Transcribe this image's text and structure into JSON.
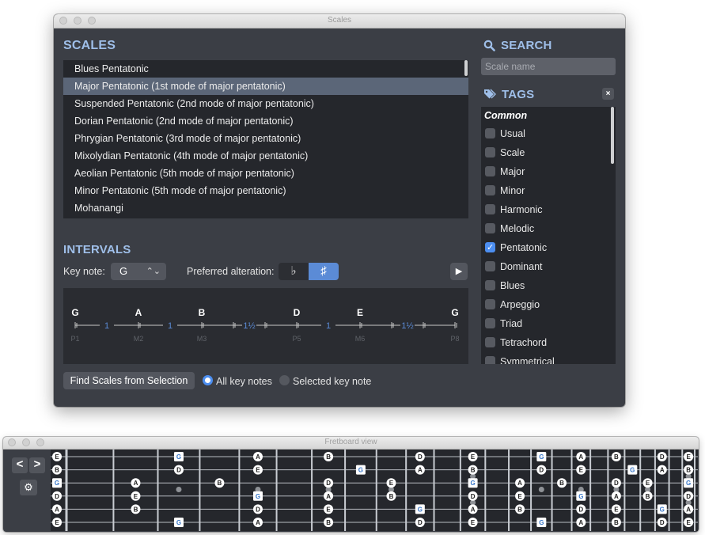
{
  "scales_window": {
    "title": "Scales",
    "scales_heading": "SCALES",
    "scales": [
      "Blues Pentatonic",
      "Major Pentatonic (1st mode of major pentatonic)",
      "Suspended Pentatonic (2nd mode of major pentatonic)",
      "Dorian Pentatonic (2nd mode of major pentatonic)",
      "Phrygian Pentatonic (3rd mode of major pentatonic)",
      "Mixolydian Pentatonic (4th mode of major pentatonic)",
      "Aeolian Pentatonic (5th mode of major pentatonic)",
      "Minor Pentatonic (5th mode of major pentatonic)",
      "Mohanangi"
    ],
    "selected_scale": "Major Pentatonic (1st mode of major pentatonic)",
    "intervals_heading": "INTERVALS",
    "key_note_label": "Key note:",
    "key_note_value": "G",
    "key_note_arrows": "⌃⌄",
    "preferred_alteration_label": "Preferred alteration:",
    "flat_symbol": "♭",
    "sharp_symbol": "♯",
    "selected_alteration": "sharp",
    "play_symbol": "▶",
    "intervals": {
      "notes": [
        "G",
        "A",
        "B",
        "D",
        "E",
        "G"
      ],
      "degrees": [
        "P1",
        "M2",
        "M3",
        "P5",
        "M6",
        "P8"
      ],
      "steps": [
        "1",
        "1",
        "1½",
        "1",
        "1½"
      ],
      "step_semitones": [
        2,
        2,
        3,
        2,
        3
      ]
    },
    "find_button_label": "Find Scales from Selection",
    "radio_all_label": "All key notes",
    "radio_selected_label": "Selected key note",
    "radio_selected": "all",
    "search_heading": "SEARCH",
    "search_placeholder": "Scale name",
    "tags_heading": "TAGS",
    "clear_symbol": "×",
    "tags_group": "Common",
    "tags": [
      {
        "label": "Usual",
        "checked": false
      },
      {
        "label": "Scale",
        "checked": false
      },
      {
        "label": "Major",
        "checked": false
      },
      {
        "label": "Minor",
        "checked": false
      },
      {
        "label": "Harmonic",
        "checked": false
      },
      {
        "label": "Melodic",
        "checked": false
      },
      {
        "label": "Pentatonic",
        "checked": true
      },
      {
        "label": "Dominant",
        "checked": false
      },
      {
        "label": "Blues",
        "checked": false
      },
      {
        "label": "Arpeggio",
        "checked": false
      },
      {
        "label": "Triad",
        "checked": false
      },
      {
        "label": "Tetrachord",
        "checked": false
      },
      {
        "label": "Symmetrical",
        "checked": false
      }
    ]
  },
  "fretboard_window": {
    "title": "Fretboard view",
    "prev_symbol": "<",
    "next_symbol": ">",
    "gear_symbol": "⚙",
    "open_strings": [
      "E",
      "B",
      "G",
      "D",
      "A",
      "E"
    ],
    "root_note": "G",
    "scale_notes": [
      "G",
      "A",
      "B",
      "D",
      "E"
    ],
    "fret_count": 24,
    "inlay_frets_single": [
      3,
      5,
      7,
      9,
      15,
      17,
      19,
      21
    ],
    "inlay_frets_double": [
      12,
      24
    ],
    "colors": {
      "root": "#3a78c9",
      "note": "#222222",
      "accent": "#5b8bd6"
    }
  }
}
